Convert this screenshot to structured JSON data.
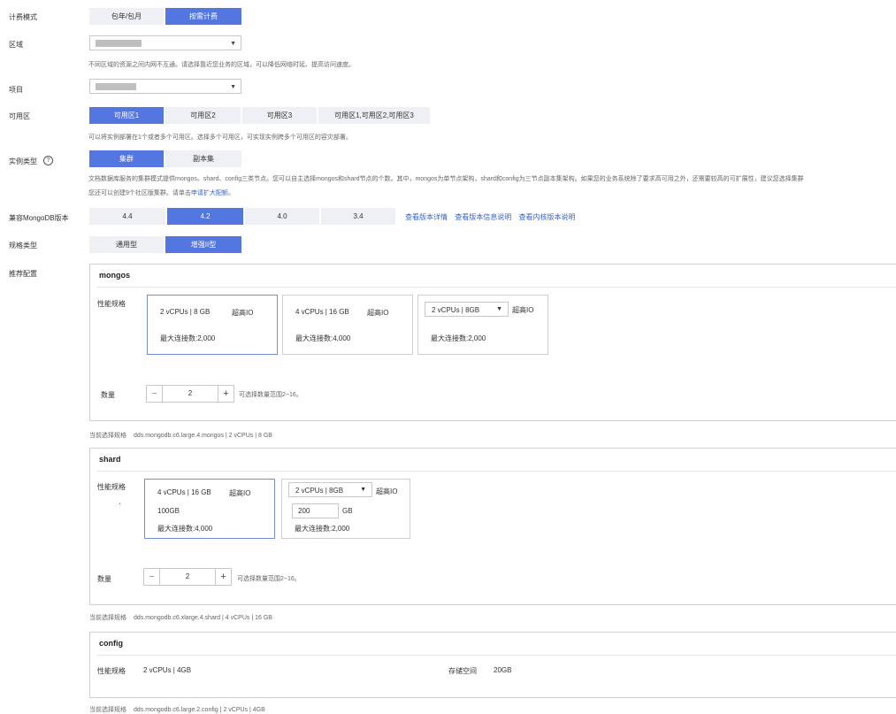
{
  "billing": {
    "label": "计费模式",
    "options": [
      "包年/包月",
      "按需计费"
    ],
    "selected": 1
  },
  "region": {
    "label": "区域",
    "hint": "不同区域的资源之间内网不互通。请选择靠近您业务的区域，可以降低网络时延、提高访问速度。"
  },
  "project": {
    "label": "项目"
  },
  "az": {
    "label": "可用区",
    "options": [
      "可用区1",
      "可用区2",
      "可用区3",
      "可用区1,可用区2,可用区3"
    ],
    "selected": 0,
    "hint": "可以将实例部署在1个或者多个可用区。选择多个可用区，可实现实例跨多个可用区的容灾部署。"
  },
  "instance_type": {
    "label": "实例类型",
    "help_icon": "question-circle-icon",
    "options": [
      "集群",
      "副本集"
    ],
    "selected": 0,
    "hint1": "文档数据库服务的集群模式提供mongos、shard、config三类节点。您可以自主选择mongos和shard节点的个数。其中，mongos为单节点架构，shard和config为三节点副本集架构。如果您的业务系统除了要求高可用之外，还需要较高的可扩展性，建议您选择集群",
    "hint2_prefix": "您还可以创建9个社区版集群。请单击",
    "hint2_link": "申请扩大配额",
    "hint2_suffix": "。"
  },
  "version": {
    "label": "兼容MongoDB版本",
    "options": [
      "4.4",
      "4.2",
      "4.0",
      "3.4"
    ],
    "selected": 1,
    "links": [
      "查看版本详情",
      "查看版本信息说明",
      "查看内核版本说明"
    ]
  },
  "spec_type": {
    "label": "规格类型",
    "options": [
      "通用型",
      "增强II型"
    ],
    "selected": 1
  },
  "recommended": {
    "label": "推荐配置"
  },
  "mongos": {
    "title": "mongos",
    "perf_label": "性能规格",
    "cards": [
      {
        "spec": "2 vCPUs | 8 GB",
        "io": "超高IO",
        "conn": "最大连接数:2,000"
      },
      {
        "spec": "4 vCPUs | 16 GB",
        "io": "超高IO",
        "conn": "最大连接数:4,000"
      },
      {
        "spec": "2 vCPUs | 8GB",
        "io": "超高IO",
        "conn": "最大连接数:2,000"
      }
    ],
    "qty_label": "数量",
    "qty": "2",
    "qty_hint": "可选择数量范围2~16。",
    "current_label": "当前选择规格",
    "current": "dds.mongodb.c6.large.4.mongos | 2 vCPUs | 8 GB"
  },
  "shard": {
    "title": "shard",
    "perf_label": "性能规格",
    "bullet": "·",
    "cards": [
      {
        "spec": "4 vCPUs | 16 GB",
        "io": "超高IO",
        "storage": "100GB",
        "conn": "最大连接数:4,000"
      },
      {
        "spec": "2 vCPUs | 8GB",
        "io": "超高IO",
        "storage": "200",
        "unit": "GB",
        "conn": "最大连接数:2,000"
      }
    ],
    "qty_label": "数量",
    "qty": "2",
    "qty_hint": "可选择数量范围2~16。",
    "current_label": "当前选择规格",
    "current": "dds.mongodb.c6.xlarge.4.shard | 4 vCPUs | 16 GB"
  },
  "config": {
    "title": "config",
    "perf_label": "性能规格",
    "perf_value": "2 vCPUs | 4GB",
    "storage_label": "存储空间",
    "storage_value": "20GB",
    "current_label": "当前选择规格",
    "current": "dds.mongodb.c6.large.2.config | 2 vCPUs | 4GB"
  },
  "icons": {
    "minus": "−",
    "plus": "+",
    "dropdown": "▼"
  }
}
